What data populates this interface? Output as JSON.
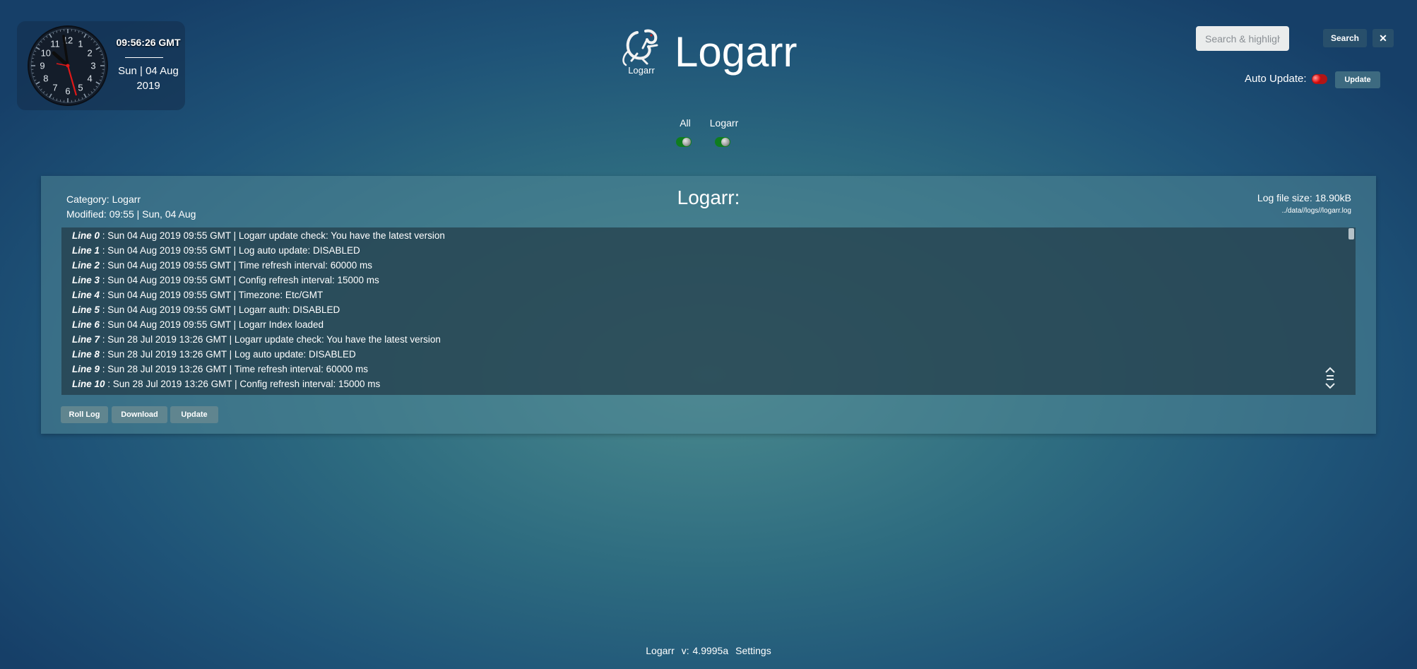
{
  "clock": {
    "time": "09:56:26 GMT",
    "date_line1": "Sun | 04 Aug",
    "date_line2": "2019",
    "numerals": [
      "12",
      "1",
      "2",
      "3",
      "4",
      "5",
      "6",
      "7",
      "8",
      "9",
      "10",
      "11"
    ]
  },
  "header": {
    "logo_small": "Logarr",
    "title": "Logarr"
  },
  "search": {
    "placeholder": "Search & highlight . . .",
    "button_label": "Search",
    "clear_label": "✕"
  },
  "auto_update": {
    "label": "Auto Update:",
    "enabled": false,
    "button_label": "Update"
  },
  "filters": [
    {
      "label": "All",
      "enabled": true
    },
    {
      "label": "Logarr",
      "enabled": true
    }
  ],
  "log_panel": {
    "category": "Category: Logarr",
    "modified": "Modified: 09:55 | Sun, 04 Aug",
    "title": "Logarr:",
    "file_size": "Log file size: 18.90kB",
    "path": "../data//logs//logarr.log",
    "lines": [
      {
        "num": "Line 0",
        "text": " : Sun 04 Aug 2019 09:55 GMT | Logarr update check: You have the latest version"
      },
      {
        "num": "Line 1",
        "text": " : Sun 04 Aug 2019 09:55 GMT | Log auto update: DISABLED"
      },
      {
        "num": "Line 2",
        "text": " : Sun 04 Aug 2019 09:55 GMT | Time refresh interval: 60000 ms"
      },
      {
        "num": "Line 3",
        "text": " : Sun 04 Aug 2019 09:55 GMT | Config refresh interval: 15000 ms"
      },
      {
        "num": "Line 4",
        "text": " : Sun 04 Aug 2019 09:55 GMT | Timezone: Etc/GMT"
      },
      {
        "num": "Line 5",
        "text": " : Sun 04 Aug 2019 09:55 GMT | Logarr auth: DISABLED"
      },
      {
        "num": "Line 6",
        "text": " : Sun 04 Aug 2019 09:55 GMT | Logarr Index loaded"
      },
      {
        "num": "Line 7",
        "text": " : Sun 28 Jul 2019 13:26 GMT | Logarr update check: You have the latest version"
      },
      {
        "num": "Line 8",
        "text": " : Sun 28 Jul 2019 13:26 GMT | Log auto update: DISABLED"
      },
      {
        "num": "Line 9",
        "text": " : Sun 28 Jul 2019 13:26 GMT | Time refresh interval: 60000 ms"
      },
      {
        "num": "Line 10",
        "text": " : Sun 28 Jul 2019 13:26 GMT | Config refresh interval: 15000 ms"
      }
    ],
    "buttons": {
      "roll": "Roll Log",
      "download": "Download",
      "update": "Update"
    }
  },
  "footer": {
    "app": "Logarr",
    "version": "v: 4.9995a",
    "settings": "Settings"
  },
  "icons": {
    "clock": "analog-clock-icon",
    "logo": "gecko-logo-icon",
    "jump": "scroll-jump-icon"
  }
}
